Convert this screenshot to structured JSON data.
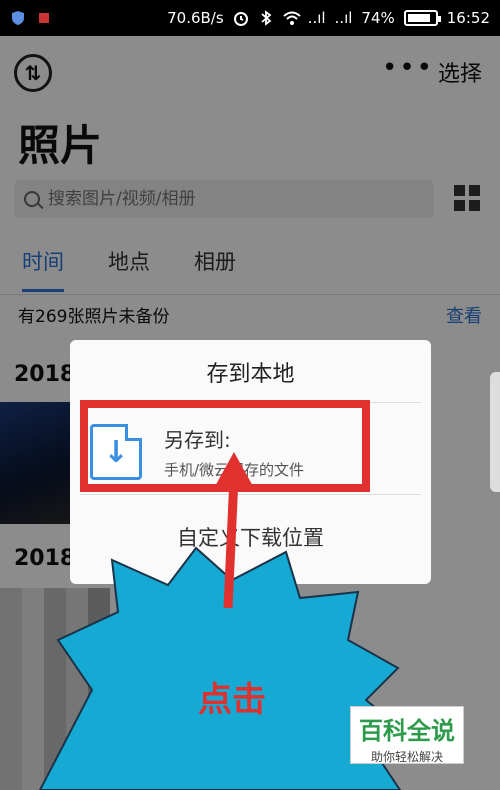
{
  "status_bar": {
    "speed": "70.6B/s",
    "signal1": "..ıl",
    "signal2": "..ıl",
    "battery": "74%",
    "battery_level": 0.74,
    "time": "16:52"
  },
  "header": {
    "more": "•••",
    "select": "选择",
    "title": "照片"
  },
  "search": {
    "placeholder": "搜索图片/视频/相册"
  },
  "tabs": [
    "时间",
    "地点",
    "相册"
  ],
  "backup": {
    "notice": "有269张照片未备份",
    "view": "查看"
  },
  "sections": [
    {
      "label": "2018"
    },
    {
      "label": "2018"
    }
  ],
  "dialog": {
    "title": "存到本地",
    "save_as_title": "另存到:",
    "save_as_subtitle": "手机/微云保存的文件",
    "custom_location": "自定义下载位置"
  },
  "annotation": {
    "label": "点击"
  },
  "watermark": {
    "title": "百科全说",
    "subtitle": "助你轻松解决"
  },
  "colors": {
    "accent": "#2a74d6",
    "annotation": "#e0312f",
    "burst": "#15a9d4",
    "icon": "#3a8fe0"
  }
}
